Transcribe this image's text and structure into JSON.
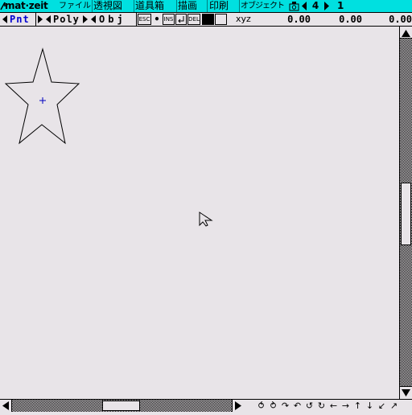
{
  "menubar": {
    "app_name": "mat·zeit",
    "menus": [
      "ファイル",
      "透視図",
      "道具箱",
      "描画",
      "印刷",
      "オブジェクト"
    ],
    "page_number": "4",
    "layer_number": "1",
    "icons": {
      "camera": "camera-icon",
      "prev": "triangle-left-icon",
      "next": "triangle-right-icon"
    },
    "accent_color": "#00e0e0"
  },
  "toolbar": {
    "modes": [
      "Pnt",
      "Poly",
      "Obj"
    ],
    "keys": [
      "ESC",
      "INS",
      "DEL"
    ],
    "coord_label": "xyz",
    "coords": [
      "0.00",
      "0.00",
      "0.00"
    ],
    "active_mode_color": "#0000d0"
  },
  "canvas": {
    "objects": [
      "star",
      "point-cursor",
      "mouse-pointer"
    ]
  },
  "bottombar": {
    "nav_icons": [
      "rotate-left-icon",
      "rotate-right-icon",
      "tilt-down-icon",
      "tilt-up-icon",
      "spin-left-icon",
      "spin-right-icon",
      "arrow-left-icon",
      "arrow-right-icon",
      "arrow-up-icon",
      "arrow-down-icon",
      "arrow-down-left-icon",
      "arrow-up-right-icon"
    ],
    "nav_glyphs": [
      "⥀",
      "⥁",
      "↷",
      "↶",
      "↺",
      "↻",
      "←",
      "→",
      "↑",
      "↓",
      "↙",
      "↗"
    ]
  }
}
